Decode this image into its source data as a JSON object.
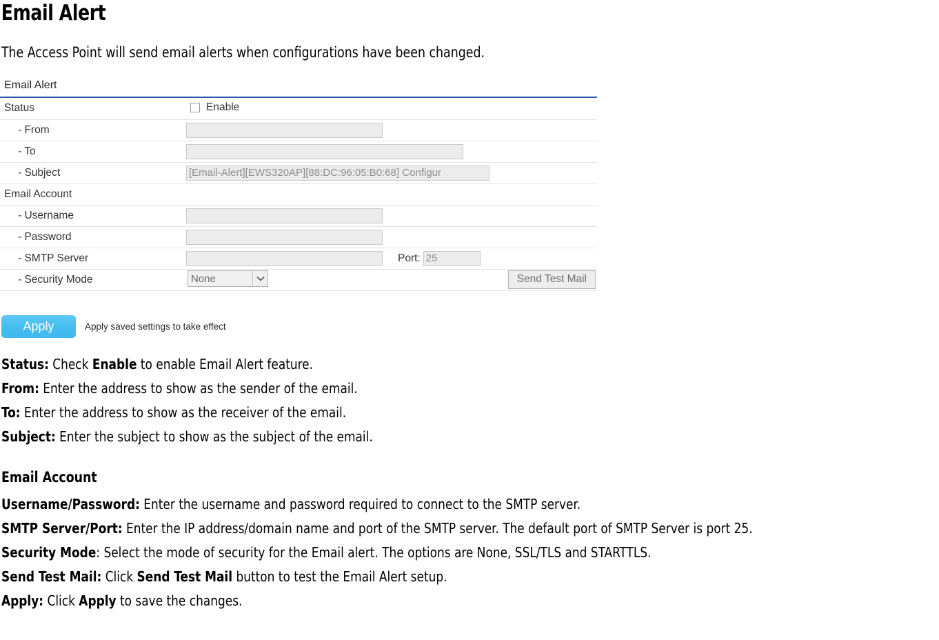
{
  "document": {
    "title": "Email Alert",
    "intro": "The Access Point will send email alerts when configurations have been changed."
  },
  "panel": {
    "section_title": "Email Alert",
    "accent_color": "#2f5bad",
    "rows": {
      "status": {
        "label": "Status",
        "checkbox_label": "Enable",
        "checked": "false"
      },
      "from": {
        "label": "- From",
        "value": ""
      },
      "to": {
        "label": "- To",
        "value": ""
      },
      "subject": {
        "label": "- Subject",
        "value": "[Email-Alert][EWS320AP][88:DC:96:05:B0:68] Configur"
      },
      "email_account_header": {
        "label": "Email Account"
      },
      "username": {
        "label": "- Username",
        "value": ""
      },
      "password": {
        "label": "- Password",
        "value": ""
      },
      "smtp_server": {
        "label": "- SMTP Server",
        "value": "",
        "port_label": "Port:",
        "port_value": "25"
      },
      "security_mode": {
        "label": "- Security Mode",
        "selected": "None",
        "options": [
          "None",
          "SSL/TLS",
          "STARTTLS"
        ],
        "test_button": "Send Test Mail"
      }
    }
  },
  "apply": {
    "button_label": "Apply",
    "note": "Apply saved settings to take effect",
    "button_color": "#45bdf0"
  },
  "descriptions": {
    "status": {
      "term": "Status:",
      "text": " Check ",
      "bold2": "Enable",
      "text2": " to enable Email Alert feature."
    },
    "from": {
      "term": "From:",
      "text": " Enter the address to show as the sender of the email."
    },
    "to": {
      "term": "To:",
      "text": " Enter the address to show as the receiver of the email."
    },
    "subject": {
      "term": "Subject:",
      "text": " Enter the subject to show as the subject of the email."
    },
    "email_account_heading": "Email Account",
    "username_password": {
      "term": "Username/Password:",
      "text": " Enter the username and password required to connect to the SMTP server."
    },
    "smtp_server_port": {
      "term": "SMTP Server/Port:",
      "text": " Enter the IP address/domain name and port of the SMTP server. The default port of SMTP Server is port 25."
    },
    "security_mode": {
      "term": "Security Mode",
      "text": ": Select the mode of security for the Email alert. The options are None, SSL/TLS and STARTTLS."
    },
    "send_test_mail": {
      "term": "Send Test Mail:",
      "text": " Click ",
      "bold2": "Send Test Mail",
      "text2": " button to test the Email Alert setup."
    },
    "apply": {
      "term": "Apply:",
      "text": " Click ",
      "bold2": "Apply",
      "text2": " to save the changes."
    }
  }
}
